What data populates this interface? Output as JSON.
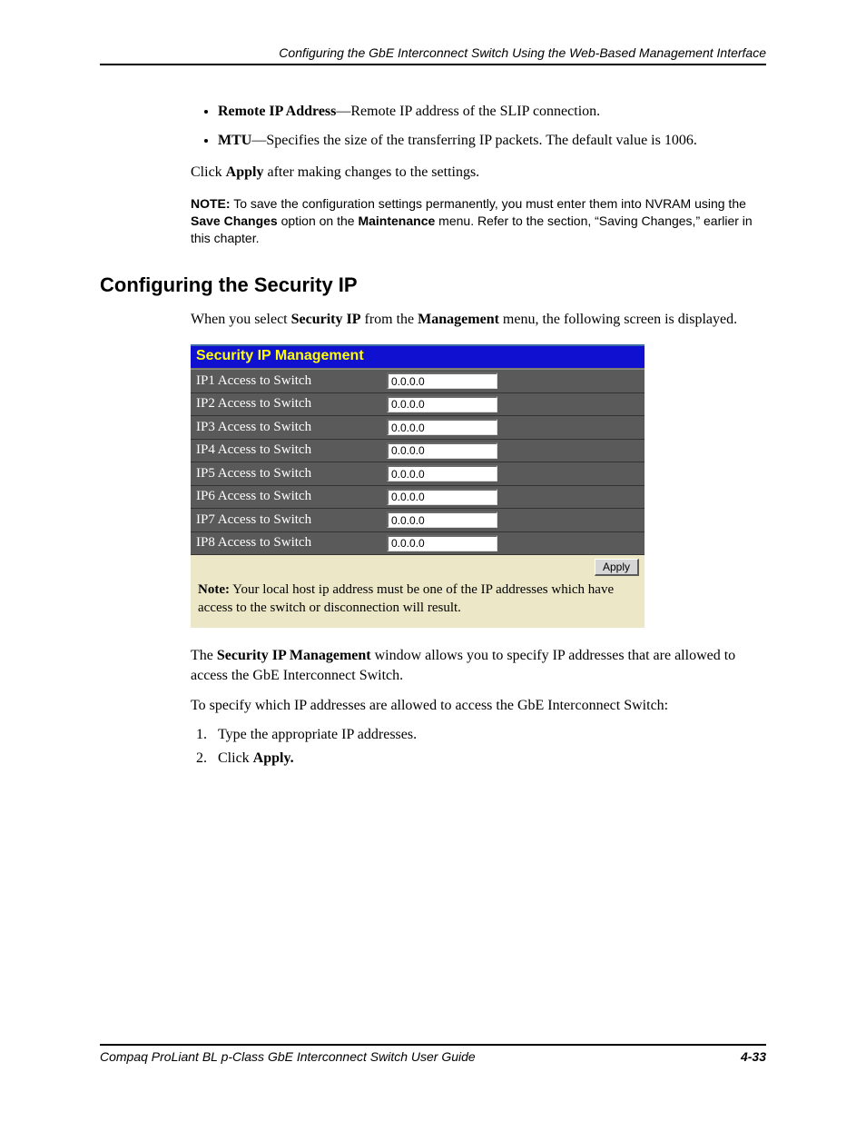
{
  "header": {
    "running_title": "Configuring the GbE Interconnect Switch Using the Web-Based Management Interface"
  },
  "bullets": [
    {
      "term": "Remote IP Address",
      "desc": "—Remote IP address of the SLIP connection."
    },
    {
      "term": "MTU",
      "desc": "—Specifies the size of the transferring IP packets. The default value is 1006."
    }
  ],
  "apply_para": {
    "pre": "Click ",
    "bold": "Apply",
    "post": " after making changes to the settings."
  },
  "note1": {
    "label": "NOTE:",
    "text_pre": "  To save the configuration settings permanently, you must enter them into NVRAM using the ",
    "bold1": "Save Changes",
    "mid": " option on the ",
    "bold2": "Maintenance",
    "post": " menu. Refer to the section, “Saving Changes,” earlier in this chapter."
  },
  "section_heading": "Configuring the Security IP",
  "intro_para": {
    "pre": "When you select ",
    "bold1": "Security IP",
    "mid": " from the ",
    "bold2": "Management",
    "post": " menu, the following screen is displayed."
  },
  "panel": {
    "title": "Security IP Management",
    "rows": [
      {
        "label": "IP1 Access to Switch",
        "value": "0.0.0.0"
      },
      {
        "label": "IP2 Access to Switch",
        "value": "0.0.0.0"
      },
      {
        "label": "IP3 Access to Switch",
        "value": "0.0.0.0"
      },
      {
        "label": "IP4 Access to Switch",
        "value": "0.0.0.0"
      },
      {
        "label": "IP5 Access to Switch",
        "value": "0.0.0.0"
      },
      {
        "label": "IP6 Access to Switch",
        "value": "0.0.0.0"
      },
      {
        "label": "IP7 Access to Switch",
        "value": "0.0.0.0"
      },
      {
        "label": "IP8 Access to Switch",
        "value": "0.0.0.0"
      }
    ],
    "apply_label": "Apply",
    "note_label": "Note:",
    "note_text": " Your local host ip address must be one of the IP addresses which have access to the switch or disconnection will result."
  },
  "post_panel_para": {
    "pre": "The ",
    "bold": "Security IP Management",
    "post": " window allows you to specify IP addresses that are allowed to access the GbE Interconnect Switch."
  },
  "instr_intro": "To specify which IP addresses are allowed to access the GbE Interconnect Switch:",
  "steps": {
    "s1": "Type the appropriate IP addresses.",
    "s2_pre": "Click ",
    "s2_bold": "Apply."
  },
  "footer": {
    "book": "Compaq ProLiant BL p-Class GbE Interconnect Switch User Guide",
    "page": "4-33"
  }
}
